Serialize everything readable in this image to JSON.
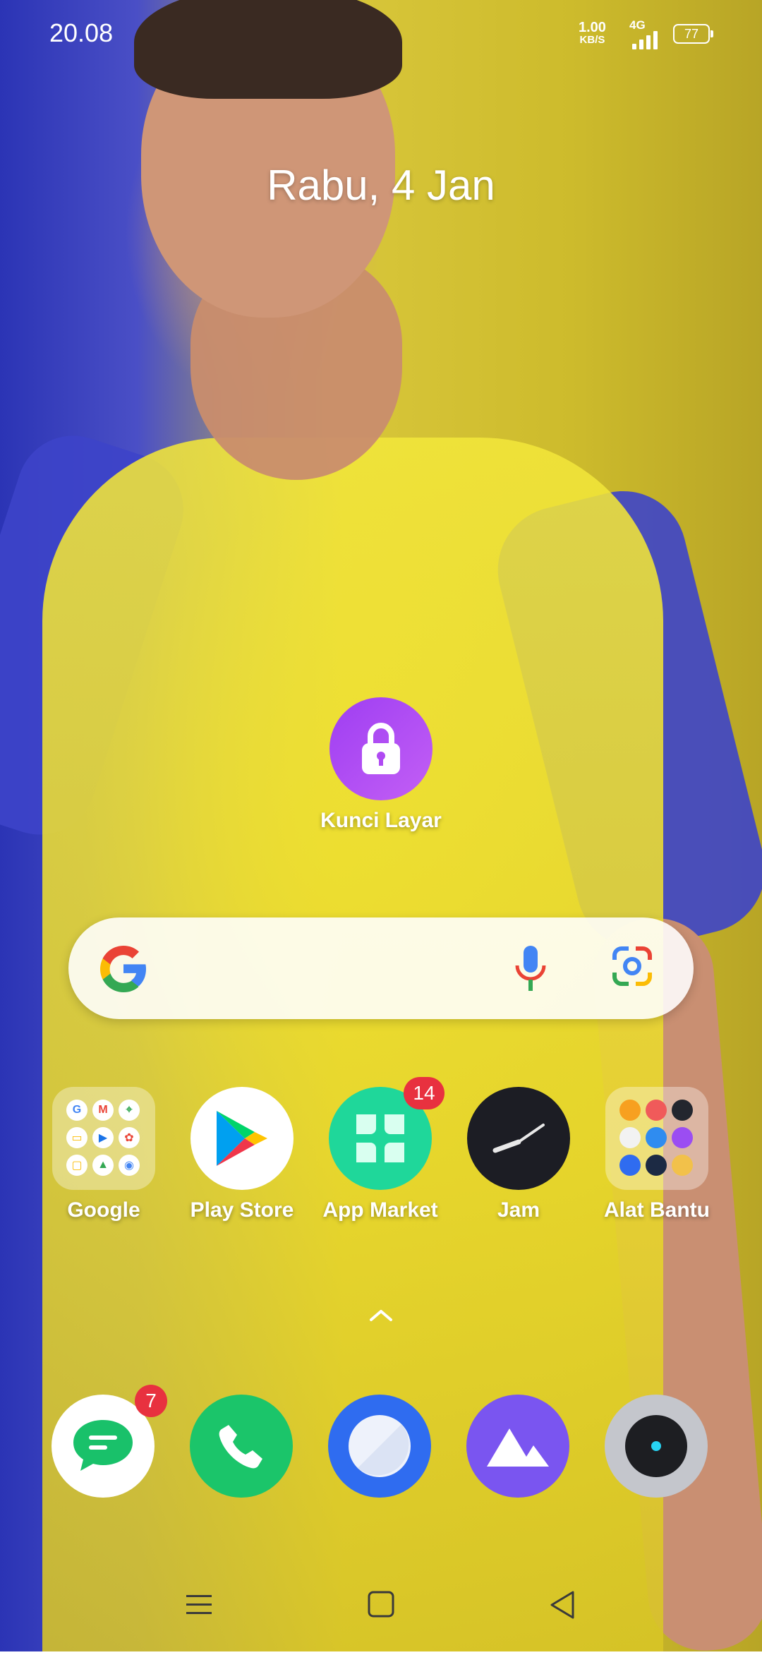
{
  "status_bar": {
    "time": "20.08",
    "net_speed_value": "1.00",
    "net_speed_unit": "KB/S",
    "network_type": "4G",
    "battery": "77"
  },
  "lockscreen_widget": {
    "date": "Rabu, 4 Jan"
  },
  "shortcut": {
    "lock_label": "Kunci Layar",
    "accent": "#b04af3"
  },
  "search_bar": {
    "google_logo": "google-g-icon",
    "mic_icon": "mic-icon",
    "lens_icon": "google-lens-icon"
  },
  "apps": [
    {
      "label": "Google",
      "icon": "folder-icon"
    },
    {
      "label": "Play Store",
      "icon": "play-store-icon"
    },
    {
      "label": "App Market",
      "icon": "app-market-icon",
      "badge": "14"
    },
    {
      "label": "Jam",
      "icon": "clock-icon"
    },
    {
      "label": "Alat Bantu",
      "icon": "folder-icon"
    }
  ],
  "google_folder_letters": [
    "G",
    "M",
    "⌖",
    "▭",
    "▶",
    "✿",
    "▢",
    "▲",
    "◉"
  ],
  "dock": [
    {
      "name": "messages",
      "icon": "message-icon",
      "badge": "7"
    },
    {
      "name": "phone",
      "icon": "phone-icon"
    },
    {
      "name": "browser",
      "icon": "browser-icon"
    },
    {
      "name": "gallery",
      "icon": "gallery-icon"
    },
    {
      "name": "camera",
      "icon": "camera-icon"
    }
  ],
  "colors": {
    "badge": "#e8313f",
    "app_market": "#1fd79a",
    "phone": "#1bc56a",
    "browser": "#2f6cf0",
    "gallery": "#7a55f0"
  }
}
